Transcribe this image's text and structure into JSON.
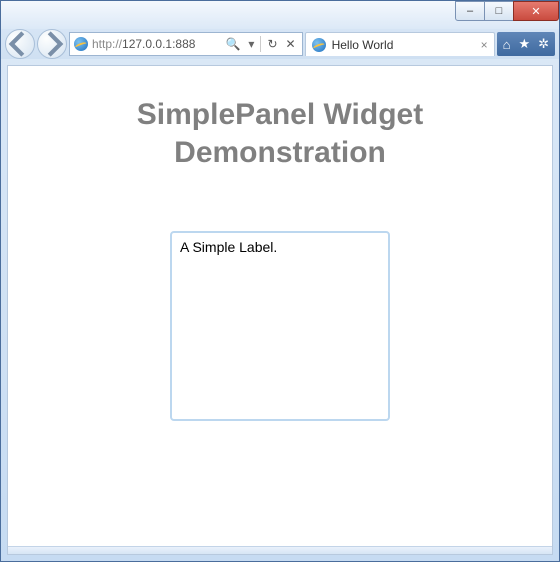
{
  "window": {
    "min_label": "–",
    "max_label": "□",
    "close_label": "✕"
  },
  "nav": {
    "url_proto": "http://",
    "url_host": "127.0.0.1:888",
    "search_icon": "🔍",
    "dropdown_icon": "▾",
    "refresh_icon": "↻",
    "stop_icon": "✕"
  },
  "tab": {
    "title": "Hello World",
    "close": "×"
  },
  "toolbar": {
    "home_icon": "⌂",
    "star_icon": "★",
    "gear_icon": "✲"
  },
  "page": {
    "heading_line1": "SimplePanel Widget",
    "heading_line2": "Demonstration",
    "panel_label": "A Simple Label."
  }
}
